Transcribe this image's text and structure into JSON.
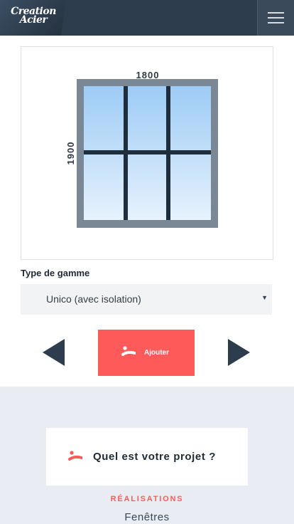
{
  "header": {
    "logo_line1": "Creation",
    "logo_line2": "Acier",
    "menu_icon": "hamburger-icon"
  },
  "configurator": {
    "width_label": "1800",
    "height_label": "1900",
    "window_columns": 3,
    "window_rows": 2
  },
  "range": {
    "label": "Type de gamme",
    "selected": "Unico (avec isolation)"
  },
  "actions": {
    "add_label": "Ajouter",
    "prev_icon": "triangle-left-icon",
    "next_icon": "triangle-right-icon"
  },
  "project": {
    "label": "Quel est votre projet ?"
  },
  "footer": {
    "section_title": "RÉALISATIONS",
    "first_link": "Fenêtres"
  },
  "colors": {
    "header_bg": "#2e3d4d",
    "accent": "#ff5a5a",
    "frame_gray": "#7a8896",
    "mullion_dark": "#1f2e3c",
    "glass_top": "#9dcbf5",
    "glass_bottom": "#e6f2fd",
    "lower_bg": "#e9edf3"
  }
}
